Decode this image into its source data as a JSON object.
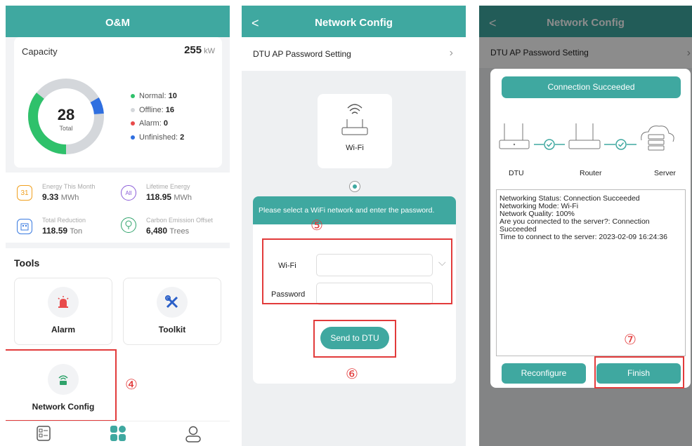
{
  "panel1": {
    "title": "O&M",
    "capacity": {
      "label": "Capacity",
      "value": "255",
      "unit": "kW"
    },
    "donut": {
      "total": "28",
      "total_label": "Total"
    },
    "legend": [
      {
        "label": "Normal:",
        "value": "10",
        "color": "#2fc16b"
      },
      {
        "label": "Offline:",
        "value": "16",
        "color": "#d4d7db"
      },
      {
        "label": "Alarm:",
        "value": "0",
        "color": "#e84b4b"
      },
      {
        "label": "Unfinished:",
        "value": "2",
        "color": "#2f6fe0"
      }
    ],
    "stats": [
      {
        "label": "Energy This Month",
        "value": "9.33",
        "unit": "MWh",
        "icon": "calendar-icon",
        "icon_text": "31"
      },
      {
        "label": "Lifetime Energy",
        "value": "118.95",
        "unit": "MWh",
        "icon": "all-icon",
        "icon_text": "All"
      },
      {
        "label": "Total Reduction",
        "value": "118.59",
        "unit": "Ton",
        "icon": "building-icon",
        "icon_text": ""
      },
      {
        "label": "Carbon Emission Offset",
        "value": "6,480",
        "unit": "Trees",
        "icon": "tree-icon",
        "icon_text": ""
      }
    ],
    "tools_title": "Tools",
    "tools": [
      {
        "label": "Alarm",
        "icon": "alarm-icon"
      },
      {
        "label": "Toolkit",
        "icon": "toolkit-icon"
      },
      {
        "label": "Network Config",
        "icon": "router-icon"
      }
    ],
    "step_marker": "④"
  },
  "panel2": {
    "title": "Network Config",
    "setting_row": "DTU AP Password Setting",
    "wifi_card_label": "Wi-Fi",
    "banner": "Please select a WiFi network and enter the password.",
    "wifi_label": "Wi-Fi",
    "password_label": "Password",
    "send_button": "Send to DTU",
    "step_marker_5": "⑤",
    "step_marker_6": "⑥"
  },
  "panel3": {
    "title": "Network Config",
    "setting_row": "DTU AP Password Setting",
    "modal_title": "Connection Succeeded",
    "devices": [
      "DTU",
      "Router",
      "Server"
    ],
    "status_lines": [
      "Networking Status: Connection Succeeded",
      "Networking Mode: Wi-Fi",
      "Network Quality: 100%",
      "Are you connected to the server?: Connection Succeeded",
      "Time to connect to the server: 2023-02-09 16:24:36"
    ],
    "reconfigure_button": "Reconfigure",
    "finish_button": "Finish",
    "step_marker": "⑦"
  }
}
